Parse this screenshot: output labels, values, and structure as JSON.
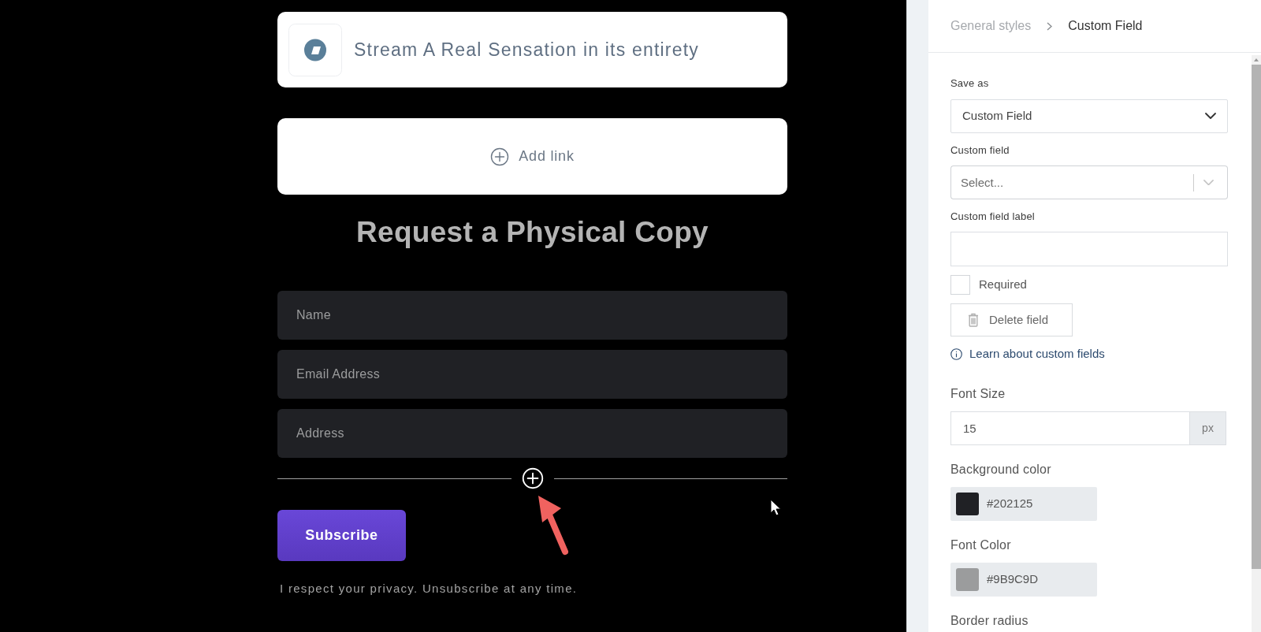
{
  "preview": {
    "link_cards": [
      {
        "kind": "link",
        "label": "Stream A Real Sensation in its entirety"
      },
      {
        "kind": "add",
        "label": "Add link"
      }
    ],
    "form": {
      "title": "Request a Physical Copy",
      "fields": [
        {
          "placeholder": "Name"
        },
        {
          "placeholder": "Email Address"
        },
        {
          "placeholder": "Address"
        }
      ],
      "submit": "Subscribe",
      "note": "I respect your privacy. Unsubscribe at any time."
    }
  },
  "panel": {
    "breadcrumb": [
      {
        "label": "General styles",
        "selected": false
      },
      {
        "label": "Custom Field",
        "selected": true
      }
    ],
    "settings": [
      {
        "kind": "select",
        "label": "Save as",
        "value": "Custom Field"
      },
      {
        "kind": "combobox",
        "label": "Custom field",
        "placeholder": "Select..."
      },
      {
        "kind": "text",
        "label": "Custom field label"
      },
      {
        "kind": "checkbox",
        "label": "Required",
        "checked": false
      },
      {
        "kind": "button",
        "label": "Delete field"
      },
      {
        "kind": "link",
        "label": "Learn about custom fields"
      },
      {
        "kind": "unit",
        "label": "Font Size",
        "value": "15",
        "unit": "px"
      },
      {
        "kind": "color",
        "label": "Background color",
        "value": "#202125",
        "color": "#202125"
      },
      {
        "kind": "color",
        "label": "Font Color",
        "value": "#9B9C9D",
        "color": "#9b9c9d"
      },
      {
        "kind": "heading",
        "label": "Border radius"
      }
    ]
  }
}
